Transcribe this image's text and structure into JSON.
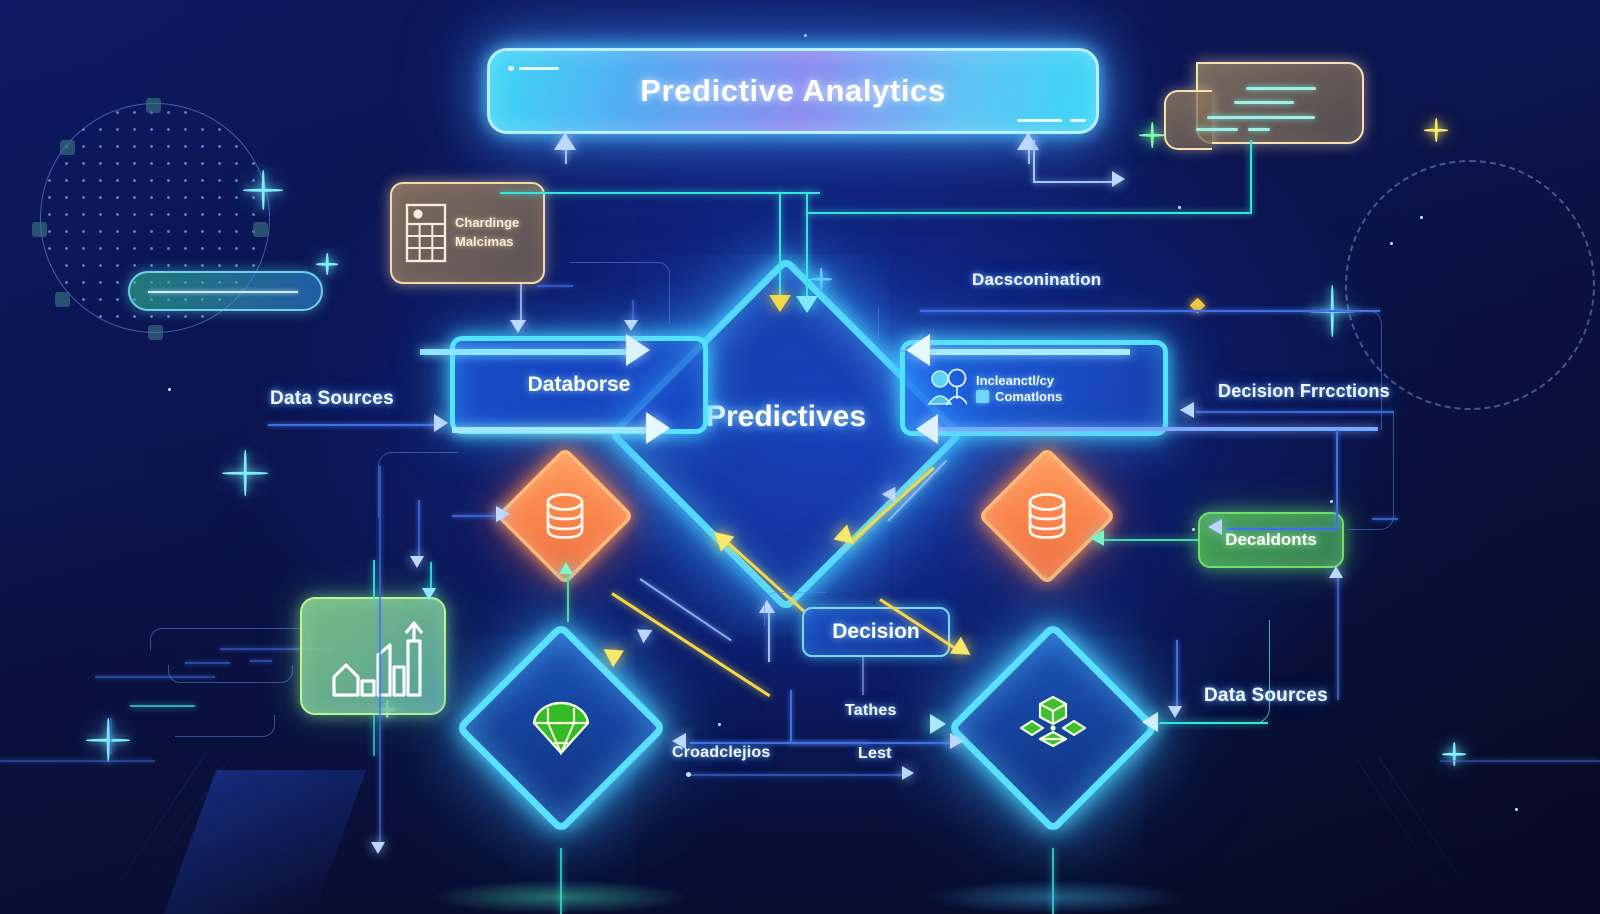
{
  "diagram": {
    "title": "Predictive Analytics",
    "background_color": "#0b1240",
    "accent_cyan": "#57d9ff",
    "accent_orange": "#f4713f",
    "accent_green": "#4ab052",
    "accent_yellow": "#f3d84a"
  },
  "center": {
    "label": "Predictives",
    "shape": "diamond"
  },
  "boxes": {
    "database": {
      "label": "Databorse",
      "color": "#54e3ff"
    },
    "interactions": {
      "line1": "Incleanctl/cy",
      "line2": "Comatlons",
      "color": "#54e3ff"
    },
    "decision": {
      "label": "Decision",
      "color": "#7fd9ff"
    },
    "challenge": {
      "line1": "Chardinge",
      "line2": "Malcimas",
      "color": "#f6d9a2"
    },
    "decaldonts": {
      "label": "Decaldonts",
      "color": "#6ee06a"
    }
  },
  "labels": {
    "data_sources_left": "Data Sources",
    "data_sources_right": "Data Sources",
    "dacsconination": "Dacsconination",
    "decision_functions": "Decision Frrcctions",
    "tathes": "Tathes",
    "croadclejios": "Croadclejios",
    "lest": "Lest"
  },
  "icons": {
    "database_left": "database-cylinder-icon",
    "database_right": "database-cylinder-icon",
    "gem": "green-gem-icon",
    "cubes": "green-cubes-icon",
    "chart": "bar-chart-growth-icon",
    "calculator": "calculator-grid-icon",
    "users": "user-group-icon",
    "note": "note-card-icon"
  }
}
